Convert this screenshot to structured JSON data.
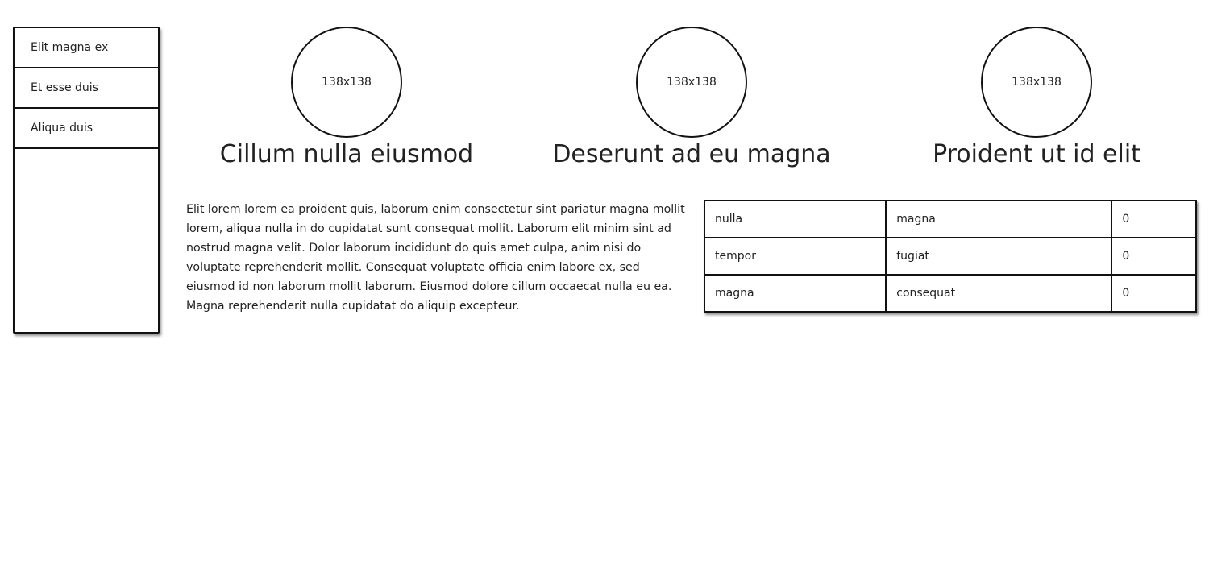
{
  "sidebar": {
    "items": [
      {
        "label": "Elit magna ex"
      },
      {
        "label": "Et esse duis"
      },
      {
        "label": "Aliqua duis"
      }
    ]
  },
  "cards": [
    {
      "image_label": "138x138",
      "title": "Cillum nulla eiusmod"
    },
    {
      "image_label": "138x138",
      "title": "Deserunt ad eu magna"
    },
    {
      "image_label": "138x138",
      "title": "Proident ut id elit"
    }
  ],
  "paragraph": "Elit lorem lorem ea proident quis, laborum enim consectetur sint pariatur magna mollit lorem, aliqua nulla in do cupidatat sunt consequat mollit. Laborum elit minim sint ad nostrud magna velit. Dolor laborum incididunt do quis amet culpa, anim nisi do voluptate reprehenderit mollit. Consequat voluptate officia enim labore ex, sed eiusmod id non laborum mollit laborum. Eiusmod dolore cillum occaecat nulla eu ea. Magna reprehenderit nulla cupidatat do aliquip excepteur.",
  "table": {
    "rows": [
      [
        "nulla",
        "magna",
        "0"
      ],
      [
        "tempor",
        "fugiat",
        "0"
      ],
      [
        "magna",
        "consequat",
        "0"
      ]
    ]
  }
}
